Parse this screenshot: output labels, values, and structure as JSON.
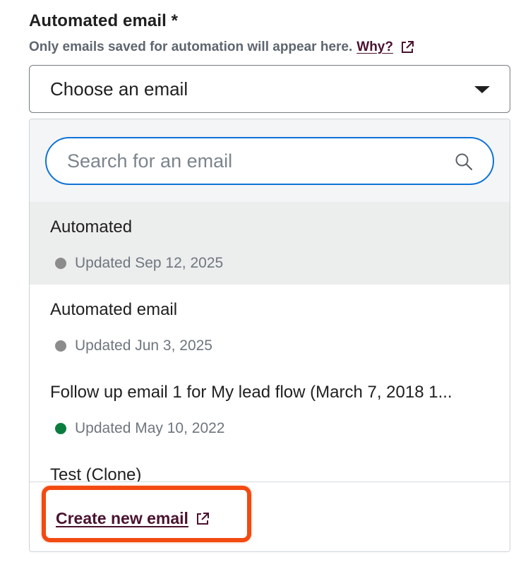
{
  "field": {
    "label": "Automated email *",
    "help_text": "Only emails saved for automation will appear here.",
    "help_link": "Why?",
    "help_link_icon": "external-link-icon"
  },
  "select": {
    "value": "Choose an email",
    "caret_icon": "caret-down-icon"
  },
  "search": {
    "placeholder": "Search for an email",
    "value": "",
    "icon": "search-icon"
  },
  "options": [
    {
      "title": "Automated",
      "meta": "Updated Sep 12, 2025",
      "status_color": "#8c8c8c",
      "highlighted": true
    },
    {
      "title": "Automated email",
      "meta": "Updated Jun 3, 2025",
      "status_color": "#8c8c8c",
      "highlighted": false
    },
    {
      "title": "Follow up email 1 for My lead flow (March 7, 2018 1...",
      "meta": "Updated May 10, 2022",
      "status_color": "#0a7d3e",
      "highlighted": false
    },
    {
      "title": "Test (Clone)",
      "meta": "",
      "status_color": "",
      "highlighted": false
    }
  ],
  "footer": {
    "create_label": "Create new email",
    "create_icon": "external-link-icon",
    "highlight_color": "#f24a10"
  },
  "colors": {
    "accent": "#0f73d6",
    "link": "#4a1230"
  }
}
